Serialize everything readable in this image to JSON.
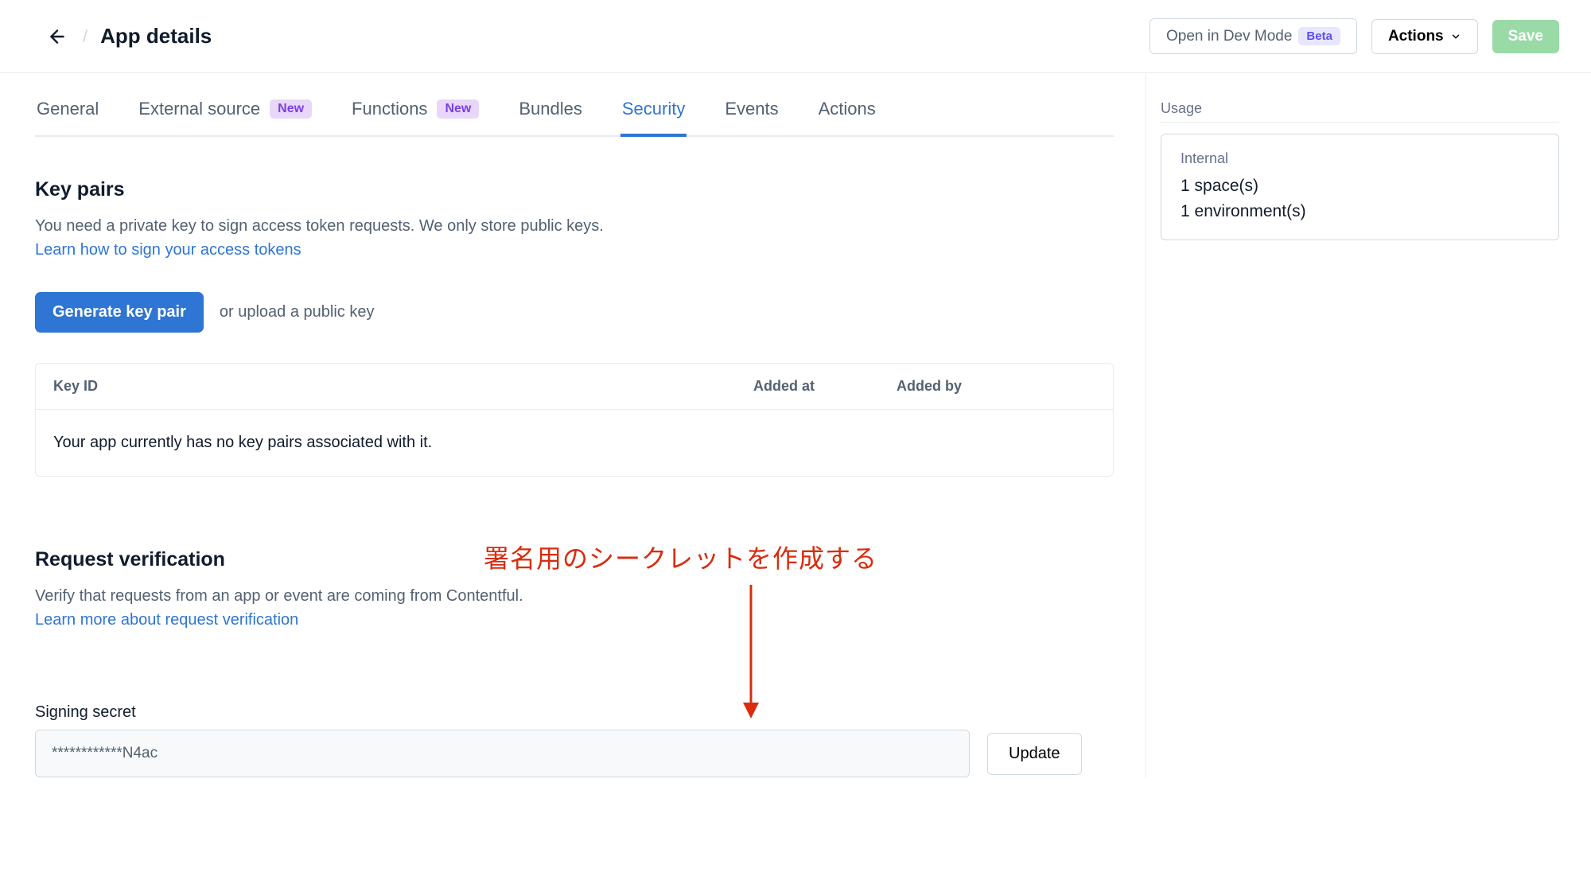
{
  "header": {
    "title": "App details",
    "devmode_label": "Open in Dev Mode",
    "devmode_badge": "Beta",
    "actions_label": "Actions",
    "save_label": "Save"
  },
  "tabs": [
    {
      "label": "General",
      "badge": null,
      "active": false
    },
    {
      "label": "External source",
      "badge": "New",
      "active": false
    },
    {
      "label": "Functions",
      "badge": "New",
      "active": false
    },
    {
      "label": "Bundles",
      "badge": null,
      "active": false
    },
    {
      "label": "Security",
      "badge": null,
      "active": true
    },
    {
      "label": "Events",
      "badge": null,
      "active": false
    },
    {
      "label": "Actions",
      "badge": null,
      "active": false
    }
  ],
  "keypairs": {
    "heading": "Key pairs",
    "description": "You need a private key to sign access token requests. We only store public keys.",
    "link_text": "Learn how to sign your access tokens",
    "generate_button": "Generate key pair",
    "upload_text": "or upload a public key",
    "table": {
      "columns": [
        "Key ID",
        "Added at",
        "Added by"
      ],
      "empty_text": "Your app currently has no key pairs associated with it."
    }
  },
  "request_verification": {
    "heading": "Request verification",
    "description": "Verify that requests from an app or event are coming from Contentful.",
    "link_text": "Learn more about request verification",
    "annotation": "署名用のシークレットを作成する",
    "signing_label": "Signing secret",
    "signing_value": "************N4ac",
    "update_button": "Update"
  },
  "usage": {
    "title": "Usage",
    "card_label": "Internal",
    "spaces": "1 space(s)",
    "environments": "1 environment(s)"
  }
}
